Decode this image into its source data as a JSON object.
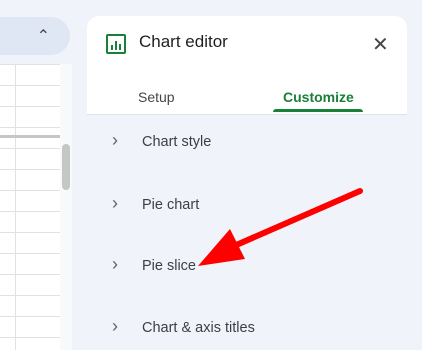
{
  "sheet": {
    "collapse_icon": "chevron-up-icon",
    "collapse_glyph": "⌃"
  },
  "editor": {
    "icon": "chart-icon",
    "title": "Chart editor",
    "close_icon": "close-icon",
    "close_glyph": "✕",
    "tabs": [
      {
        "label": "Setup",
        "active": false
      },
      {
        "label": "Customize",
        "active": true
      }
    ],
    "sections": [
      {
        "label": "Chart style",
        "icon": "chevron-right-icon",
        "glyph": "›"
      },
      {
        "label": "Pie chart",
        "icon": "chevron-right-icon",
        "glyph": "›"
      },
      {
        "label": "Pie slice",
        "icon": "chevron-right-icon",
        "glyph": "›"
      },
      {
        "label": "Chart & axis titles",
        "icon": "chevron-right-icon",
        "glyph": "›"
      }
    ]
  },
  "annotation": {
    "type": "arrow",
    "color": "#ff0000",
    "points_to": "Pie slice"
  },
  "colors": {
    "accent": "#188038",
    "panel_bg": "#f0f4fa"
  }
}
